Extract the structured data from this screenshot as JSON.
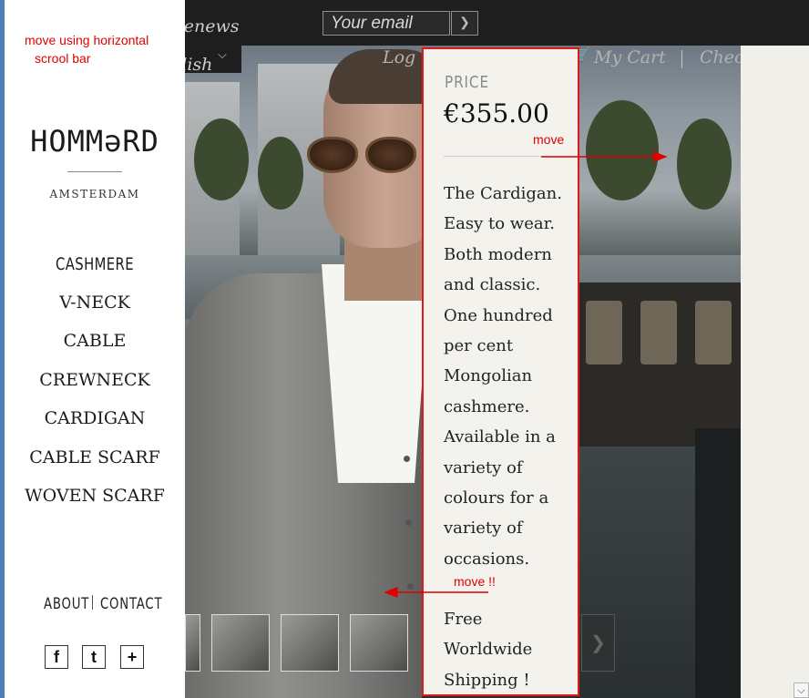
{
  "topbar": {
    "signup_text": "Sign up for stylenews",
    "email_placeholder": "Your email",
    "submit_icon": "arrow-right-icon"
  },
  "language": {
    "current": "English",
    "icon": "chevron-down-icon"
  },
  "header_links": {
    "login": "Log in or Register",
    "cart": "My Cart",
    "checkout": "Checkout",
    "cart_icon": "cart-icon"
  },
  "sidebar": {
    "note": "move using horizontal scrool bar",
    "logo": "HOMMəRD",
    "logo_sub": "AMSTERDAM",
    "nav": [
      {
        "label": "CASHMERE"
      },
      {
        "label": "V-NECK"
      },
      {
        "label": "CABLE"
      },
      {
        "label": "CREWNECK"
      },
      {
        "label": "CARDIGAN"
      },
      {
        "label": "CABLE SCARF"
      },
      {
        "label": "WOVEN SCARF"
      }
    ],
    "footer": {
      "about": "ABOUT",
      "contact": "CONTACT"
    },
    "social": [
      {
        "icon": "facebook-icon",
        "glyph": "f"
      },
      {
        "icon": "twitter-icon",
        "glyph": "t"
      },
      {
        "icon": "plus-icon",
        "glyph": "+"
      }
    ]
  },
  "product": {
    "price_label": "PRICE",
    "price": "€355.00",
    "description": "The Cardigan. Easy to wear. Both modern and classic. One hundred per cent Mongolian cashmere. Available in a variety of colours for a variety of occasions.",
    "shipping": "Free Worldwide Shipping !"
  },
  "annotations": {
    "move_right": "move",
    "move_left": "move !!"
  },
  "colors": {
    "annotation_red": "#e00000",
    "topbar_bg": "#1e1e1e",
    "panel_bg": "#f4f2ec"
  }
}
